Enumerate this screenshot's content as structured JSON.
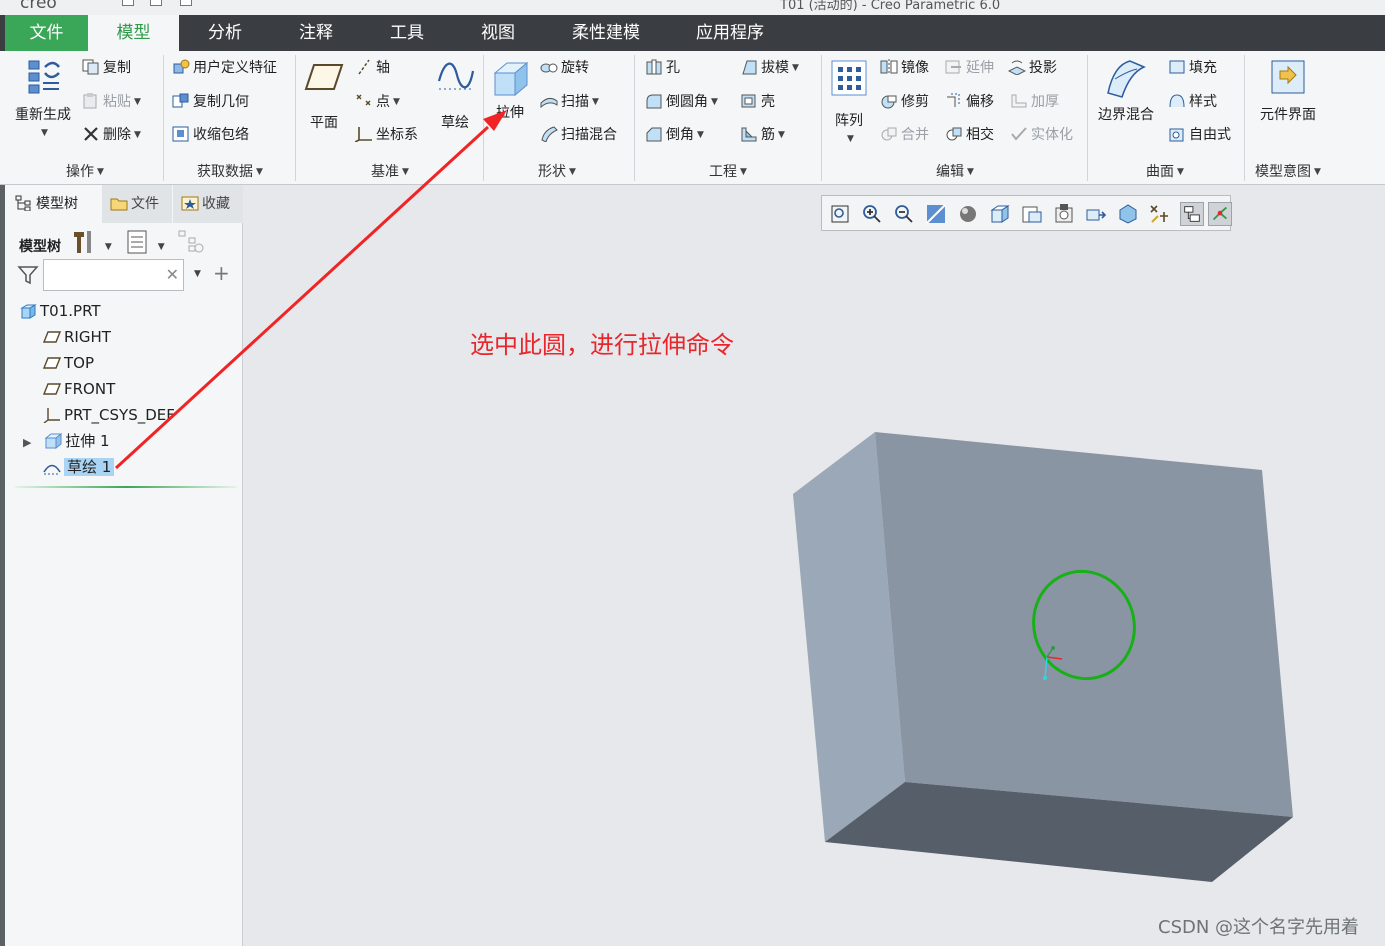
{
  "window": {
    "title": "T01 (活动的) - Creo Parametric 6.0",
    "logo": "creo"
  },
  "menu": {
    "tabs": [
      {
        "label": "文件"
      },
      {
        "label": "模型"
      },
      {
        "label": "分析"
      },
      {
        "label": "注释"
      },
      {
        "label": "工具"
      },
      {
        "label": "视图"
      },
      {
        "label": "柔性建模"
      },
      {
        "label": "应用程序"
      }
    ],
    "active": "模型"
  },
  "ribbon": {
    "operations": {
      "regenerate": "重新生成",
      "copy": "复制",
      "paste": "粘贴",
      "delete": "删除",
      "group": "操作"
    },
    "get_data": {
      "udf": "用户定义特征",
      "copy_geom": "复制几何",
      "shrinkwrap": "收缩包络",
      "group": "获取数据"
    },
    "datum": {
      "plane": "平面",
      "axis": "轴",
      "point": "点",
      "csys": "坐标系",
      "sketch": "草绘",
      "group": "基准"
    },
    "shapes": {
      "extrude": "拉伸",
      "revolve": "旋转",
      "sweep": "扫描",
      "swept_blend": "扫描混合",
      "group": "形状"
    },
    "engineering": {
      "hole": "孔",
      "round": "倒圆角",
      "chamfer": "倒角",
      "draft": "拔模",
      "shell": "壳",
      "rib": "筋",
      "group": "工程"
    },
    "editing": {
      "pattern": "阵列",
      "mirror": "镜像",
      "extend": "延伸",
      "project": "投影",
      "trim": "修剪",
      "offset": "偏移",
      "thicken": "加厚",
      "merge": "合并",
      "intersect": "相交",
      "solidify": "实体化",
      "group": "编辑"
    },
    "surfaces": {
      "boundary_blend": "边界混合",
      "fill": "填充",
      "style": "样式",
      "freestyle": "自由式",
      "group": "曲面"
    },
    "model_intent": {
      "component_interface": "元件界面",
      "group": "模型意图"
    }
  },
  "left_panel": {
    "tabs": [
      {
        "label": "模型树"
      },
      {
        "label": "文件"
      },
      {
        "label": "收藏"
      }
    ],
    "toolbar_label": "模型树",
    "search": {
      "value": "",
      "placeholder": ""
    },
    "tree": [
      {
        "label": "T01.PRT",
        "icon": "part-icon"
      },
      {
        "label": "RIGHT",
        "icon": "datum-plane-icon"
      },
      {
        "label": "TOP",
        "icon": "datum-plane-icon"
      },
      {
        "label": "FRONT",
        "icon": "datum-plane-icon"
      },
      {
        "label": "PRT_CSYS_DEF",
        "icon": "csys-icon"
      },
      {
        "label": "拉伸 1",
        "icon": "extrude-feature-icon"
      },
      {
        "label": "草绘 1",
        "icon": "sketch-feature-icon",
        "selected": true
      }
    ]
  },
  "canvas": {
    "annotation": "选中此圆，进行拉伸命令",
    "watermark": "CSDN @这个名字先用着"
  },
  "colors": {
    "menu_bg": "#3a3e43",
    "file_tab": "#3aa657",
    "accent_green": "#2e9a48",
    "selection": "#a9d4f3",
    "annotation_red": "#e8262b",
    "box_front": "#8a96a4",
    "box_side": "#9aa7b5",
    "box_bottom": "#575f69",
    "sketch_circle": "#17b117"
  }
}
